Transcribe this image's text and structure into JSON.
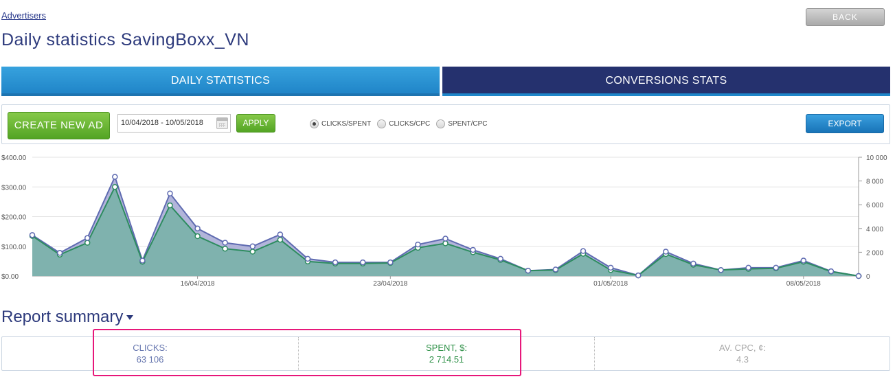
{
  "breadcrumb": {
    "label": "Advertisers"
  },
  "page": {
    "title": "Daily statistics SavingBoxx_VN"
  },
  "header": {
    "back_label": "BACK"
  },
  "tabs": [
    {
      "label": "DAILY STATISTICS",
      "active": true
    },
    {
      "label": "CONVERSIONS STATS",
      "active": false
    }
  ],
  "toolbar": {
    "create_label": "CREATE NEW AD",
    "date_range": "10/04/2018 - 10/05/2018",
    "apply_label": "APPLY",
    "radio_options": [
      {
        "label": "CLICKS/SPENT",
        "checked": true
      },
      {
        "label": "CLICKS/CPC",
        "checked": false
      },
      {
        "label": "SPENT/CPC",
        "checked": false
      }
    ],
    "export_label": "EXPORT"
  },
  "chart_data": {
    "type": "area",
    "left_axis_ticks": [
      "$0.00",
      "$100.00",
      "$200.00",
      "$300.00",
      "$400.00"
    ],
    "right_axis_ticks": [
      "0",
      "2 000",
      "4 000",
      "6 000",
      "8 000",
      "10 000"
    ],
    "left_ylim": [
      0,
      400
    ],
    "right_ylim": [
      0,
      10000
    ],
    "x_tick_labels": [
      "16/04/2018",
      "23/04/2018",
      "01/05/2018",
      "08/05/2018"
    ],
    "x_tick_indices": [
      6,
      13,
      21,
      28
    ],
    "grid": true,
    "colors": {
      "clicks": "#a4a8d4",
      "clicks_line": "#5f6bb1",
      "spent": "#7cb2ac",
      "spent_line": "#2d8c5f"
    },
    "x": [
      "10/04/2018",
      "11/04/2018",
      "12/04/2018",
      "13/04/2018",
      "14/04/2018",
      "15/04/2018",
      "16/04/2018",
      "17/04/2018",
      "18/04/2018",
      "19/04/2018",
      "20/04/2018",
      "21/04/2018",
      "22/04/2018",
      "23/04/2018",
      "24/04/2018",
      "25/04/2018",
      "26/04/2018",
      "27/04/2018",
      "28/04/2018",
      "29/04/2018",
      "30/04/2018",
      "01/05/2018",
      "02/05/2018",
      "03/05/2018",
      "04/05/2018",
      "05/05/2018",
      "06/05/2018",
      "07/05/2018",
      "08/05/2018",
      "09/05/2018",
      "10/05/2018"
    ],
    "series": [
      {
        "axis": "right",
        "values": [
          3450,
          1950,
          3200,
          8350,
          1300,
          6950,
          4000,
          2800,
          2500,
          3500,
          1450,
          1150,
          1150,
          1150,
          2650,
          3150,
          2200,
          1450,
          450,
          550,
          2100,
          700,
          50,
          2050,
          1050,
          500,
          700,
          700,
          1300,
          400,
          0
        ]
      },
      {
        "axis": "left",
        "values": [
          135,
          72,
          112,
          300,
          48,
          238,
          134,
          92,
          82,
          122,
          49,
          42,
          42,
          44,
          95,
          110,
          80,
          54,
          18,
          20,
          75,
          20,
          2,
          74,
          38,
          20,
          24,
          26,
          48,
          15,
          0
        ]
      }
    ]
  },
  "report": {
    "title": "Report summary"
  },
  "summary": {
    "clicks_label": "CLICKS:",
    "clicks_value": "63 106",
    "spent_label": "SPENT, $:",
    "spent_value": "2 714.51",
    "cpc_label": "AV. CPC, ¢:",
    "cpc_value": "4.3"
  }
}
